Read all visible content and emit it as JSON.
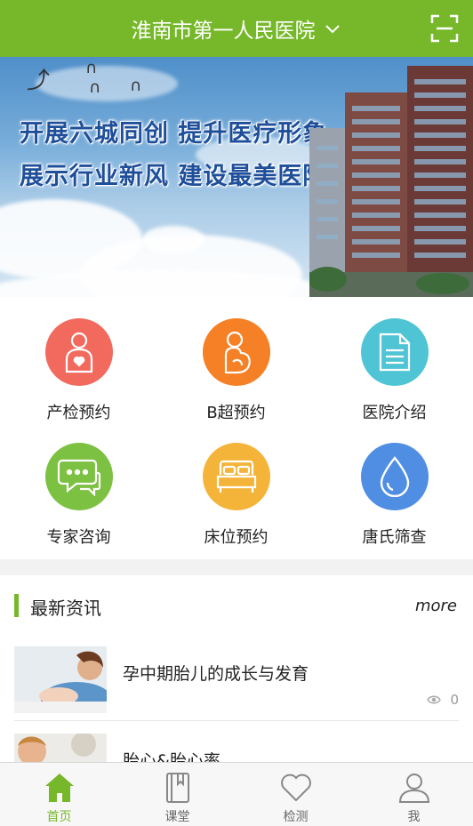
{
  "header": {
    "title": "淮南市第一人民医院",
    "accent": "#76b82a"
  },
  "banner": {
    "line1": "开展六城同创  提升医疗形象",
    "line2": "展示行业新风  建设最美医院"
  },
  "services": [
    {
      "label": "产检预约",
      "icon": "pregnant-woman-icon",
      "color": "#f26a5e"
    },
    {
      "label": "B超预约",
      "icon": "ultrasound-icon",
      "color": "#f58025"
    },
    {
      "label": "医院介绍",
      "icon": "document-icon",
      "color": "#4fc4d4"
    },
    {
      "label": "专家咨询",
      "icon": "chat-bubbles-icon",
      "color": "#7cc142"
    },
    {
      "label": "床位预约",
      "icon": "bed-icon",
      "color": "#f4b43a"
    },
    {
      "label": "唐氏筛查",
      "icon": "drop-icon",
      "color": "#4f8ee3"
    }
  ],
  "news": {
    "section_title": "最新资讯",
    "more_label": "more",
    "items": [
      {
        "title": "孕中期胎儿的成长与发育",
        "views": "0"
      },
      {
        "title": "胎心&胎心率",
        "views": ""
      }
    ]
  },
  "tabbar": {
    "items": [
      {
        "label": "首页",
        "icon": "home-icon",
        "active": true
      },
      {
        "label": "课堂",
        "icon": "book-icon",
        "active": false
      },
      {
        "label": "检测",
        "icon": "heart-icon",
        "active": false
      },
      {
        "label": "我",
        "icon": "user-icon",
        "active": false
      }
    ]
  }
}
